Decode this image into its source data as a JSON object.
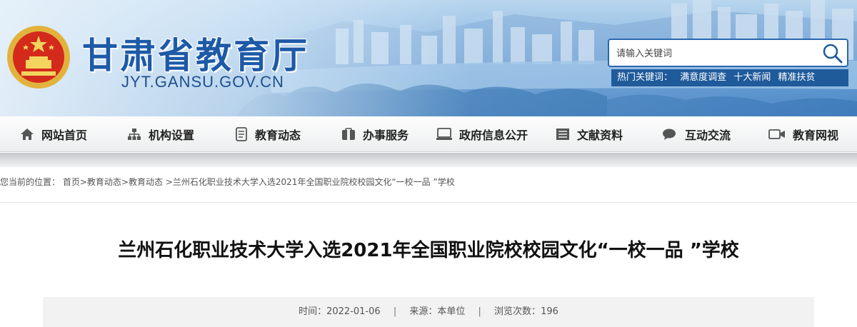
{
  "header": {
    "site_title": "甘肃省教育厅",
    "site_domain": "JYT.GANSU.GOV.CN",
    "emblem_icon": "national-emblem-icon",
    "brand_color": "#1d5aa8"
  },
  "search": {
    "placeholder": "请输入关键词",
    "hot_label": "热门关键词：",
    "hot_keywords": [
      "满意度调查",
      "十大新闻",
      "精准扶贫"
    ]
  },
  "nav": {
    "items": [
      {
        "label": "网站首页",
        "icon": "home-icon"
      },
      {
        "label": "机构设置",
        "icon": "org-chart-icon"
      },
      {
        "label": "教育动态",
        "icon": "document-icon"
      },
      {
        "label": "办事服务",
        "icon": "service-icon"
      },
      {
        "label": "政府信息公开",
        "icon": "monitor-icon"
      },
      {
        "label": "文献资料",
        "icon": "list-icon"
      },
      {
        "label": "互动交流",
        "icon": "chat-icon"
      },
      {
        "label": "教育网视",
        "icon": "video-icon"
      }
    ]
  },
  "breadcrumb": {
    "prefix": "您当前的位置：",
    "items": [
      "首页",
      "教育动态",
      "教育动态"
    ],
    "current": "兰州石化职业技术大学入选2021年全国职业院校校园文化“一校一品 ”学校"
  },
  "article": {
    "title": "兰州石化职业技术大学入选2021年全国职业院校校园文化“一校一品 ”学校",
    "time_label": "时间：",
    "time": "2022-01-06",
    "source_label": "来源：",
    "source": "本单位",
    "views_label": "浏览次数：",
    "views": "196"
  }
}
